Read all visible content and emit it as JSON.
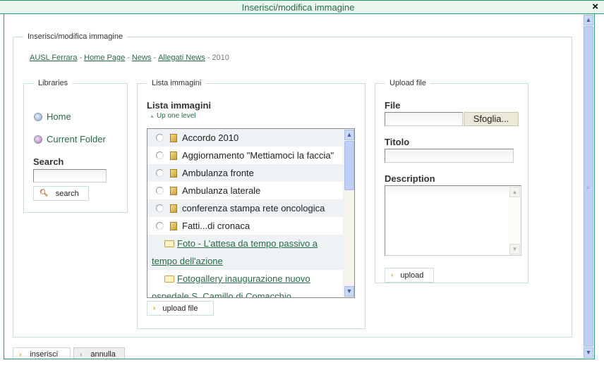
{
  "window": {
    "title": "Inserisci/modifica immagine",
    "close_icon": "×"
  },
  "outer": {
    "legend": "Inserisci/modifica immagine",
    "breadcrumb": {
      "links": [
        "AUSL Ferrara",
        "Home Page",
        "News",
        "Allegati News"
      ],
      "separator": "-",
      "current": "2010"
    }
  },
  "libraries": {
    "legend": "Libraries",
    "items": [
      {
        "label": "Home",
        "icon": "home-library-icon"
      },
      {
        "label": "Current Folder",
        "icon": "current-folder-icon"
      }
    ],
    "search_label": "Search",
    "search_value": "",
    "search_button": "search"
  },
  "lista": {
    "legend": "Lista immagini",
    "title": "Lista immagini",
    "up_one_level": "Up one level",
    "files": [
      "Accordo 2010",
      "Aggiornamento \"Mettiamoci la faccia\"",
      "Ambulanza fronte",
      "Ambulanza laterale",
      "conferenza stampa rete oncologica",
      "Fatti...di cronaca"
    ],
    "folders": [
      {
        "first": "Foto - L'attesa da tempo passivo a",
        "second": "tempo dell'azione"
      },
      {
        "first": "Fotogallery inaugurazione nuovo",
        "second": "ospedale S. Camillo di Comacchio"
      }
    ],
    "upload_file_button": "upload file"
  },
  "upload": {
    "legend": "Upload file",
    "file_label": "File",
    "file_value": "",
    "browse_button": "Sfoglia...",
    "titolo_label": "Titolo",
    "titolo_value": "",
    "description_label": "Description",
    "description_value": "",
    "upload_button": "upload"
  },
  "footer": {
    "inserisci": "inserisci",
    "annulla": "annulla"
  },
  "colors": {
    "accent": "#2a9a6e",
    "link": "#2a6a44",
    "title_bg": "#eaf5ee",
    "scrollbar": "#bfd0f6"
  }
}
